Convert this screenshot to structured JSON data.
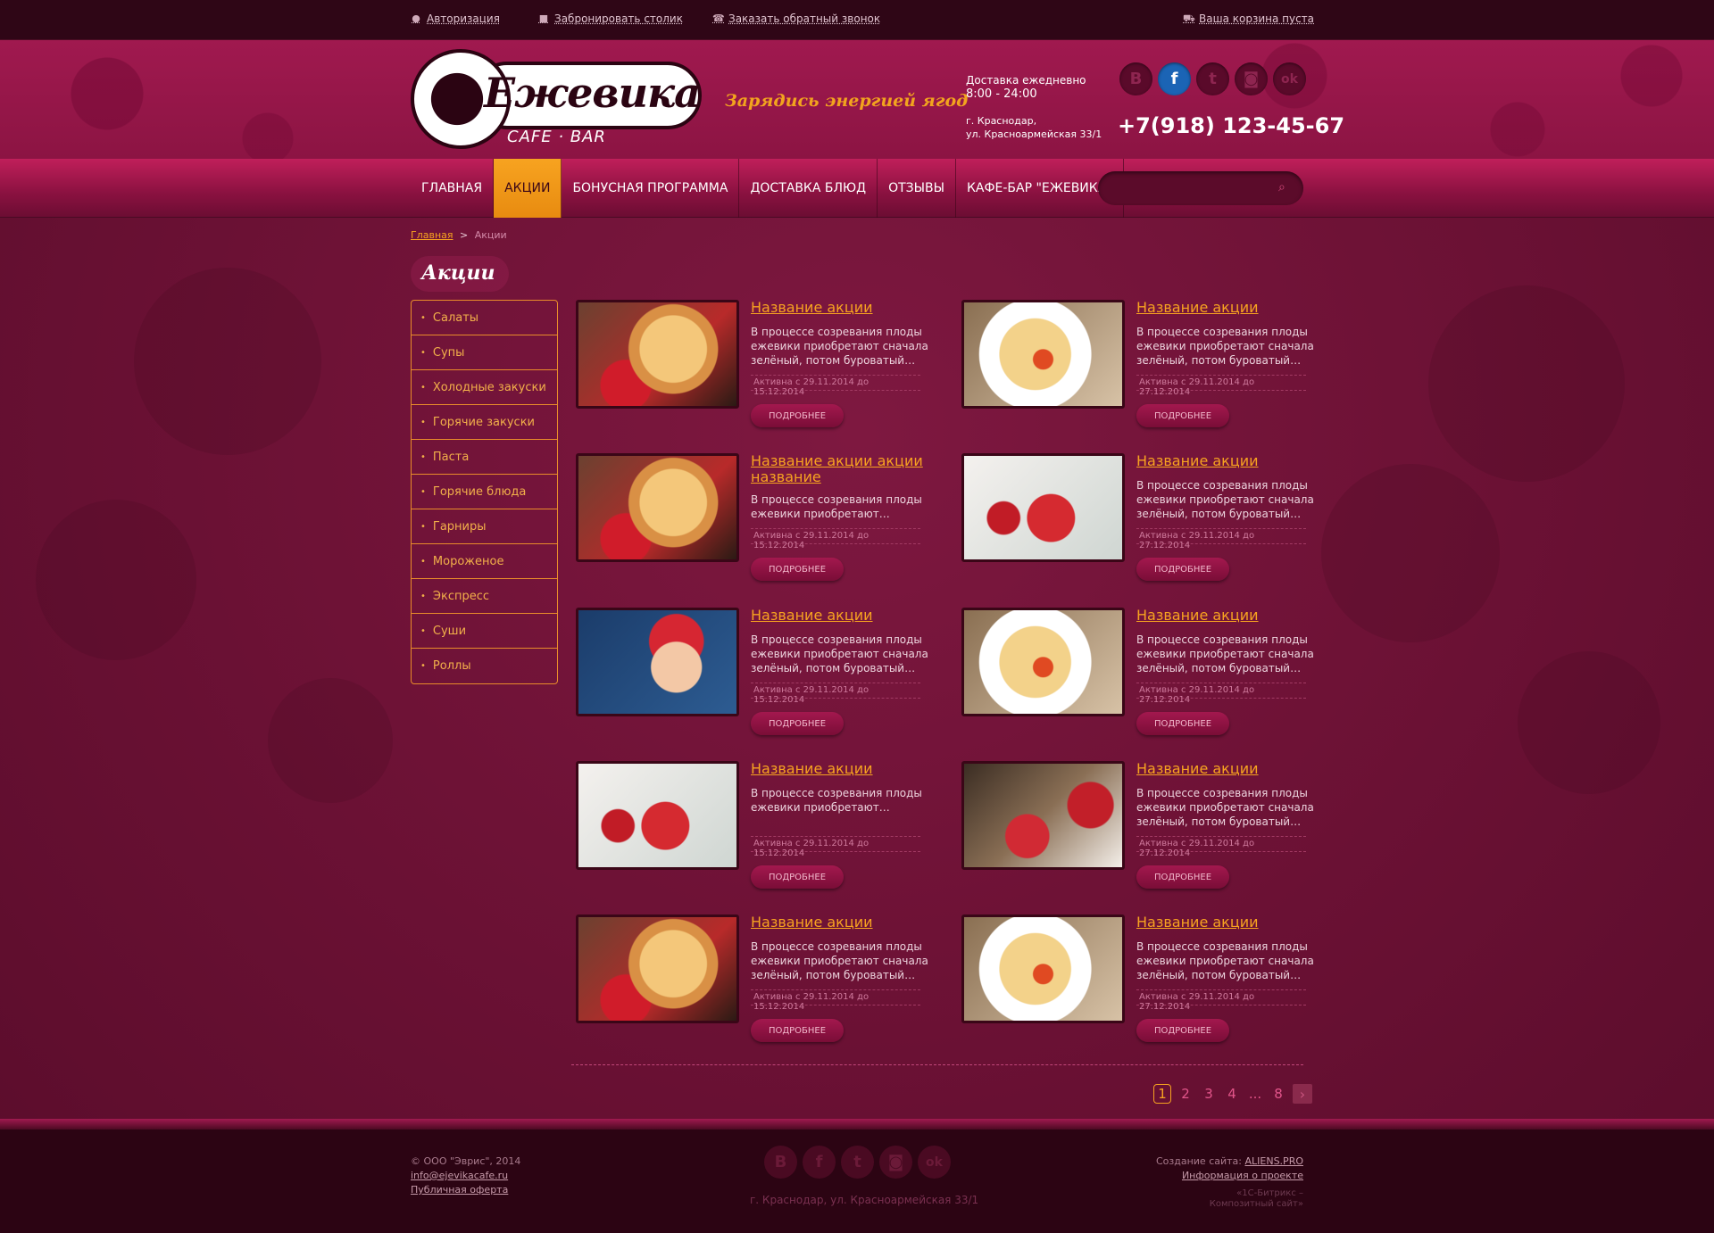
{
  "topbar": {
    "login_label": "Авторизация",
    "reserve_label": "Забронировать столик",
    "callback_label": "Заказать обратный звонок",
    "cart_label": "Ваша корзина пуста"
  },
  "header": {
    "logo_name": "Ежевика",
    "logo_sub": "CAFE · BAR",
    "slogan": "Зарядись энергией ягод",
    "delivery_line1": "Доставка ежедневно",
    "delivery_line2": "8:00 - 24:00",
    "address_line1": "г. Краснодар,",
    "address_line2": "ул. Красноармейская 33/1",
    "phone": "+7(918) 123-45-67",
    "social": [
      {
        "name": "vk-icon",
        "glyph": "B"
      },
      {
        "name": "facebook-icon",
        "glyph": "f"
      },
      {
        "name": "twitter-icon",
        "glyph": "t"
      },
      {
        "name": "instagram-icon",
        "glyph": "◙"
      },
      {
        "name": "odnoklassniki-icon",
        "glyph": "ok"
      }
    ]
  },
  "nav": {
    "items": [
      "ГЛАВНАЯ",
      "АКЦИИ",
      "БОНУСНАЯ ПРОГРАММА",
      "ДОСТАВКА БЛЮД",
      "ОТЗЫВЫ",
      "КАФЕ-БАР \"ЕЖЕВИКА\""
    ],
    "active_index": 1,
    "search_placeholder": ""
  },
  "breadcrumb": {
    "home": "Главная",
    "separator": ">",
    "current": "Акции"
  },
  "page_title": "Акции",
  "sidebar": {
    "items": [
      "Салаты",
      "Супы",
      "Холодные закуски",
      "Горячие закуски",
      "Паста",
      "Горячие блюда",
      "Гарниры",
      "Мороженое",
      "Экспресс",
      "Суши",
      "Роллы"
    ]
  },
  "cards": [
    {
      "title": "Название акции",
      "text": "В процессе созревания плоды ежевики приобретают сначала зелёный, потом буроватый…",
      "date": "Активна с 29.11.2014 до 15.12.2014",
      "button": "Подробнее",
      "image": "pancake"
    },
    {
      "title": "Название акции",
      "text": "В процессе созревания плоды ежевики приобретают сначала зелёный, потом буроватый…",
      "date": "Активна с 29.11.2014 до 27.12.2014",
      "button": "Подробнее",
      "image": "pasta"
    },
    {
      "title": "Название акции акции название",
      "text": "В процессе созревания плоды ежевики приобретают…",
      "date": "Активна с 29.11.2014 до 15.12.2014",
      "button": "Подробнее",
      "image": "pancake"
    },
    {
      "title": "Название акции",
      "text": "В процессе созревания плоды ежевики приобретают сначала зелёный, потом буроватый…",
      "date": "Активна с 29.11.2014 до 27.12.2014",
      "button": "Подробнее",
      "image": "gifts"
    },
    {
      "title": "Название акции",
      "text": "В процессе созревания плоды ежевики приобретают сначала зелёный, потом буроватый…",
      "date": "Активна с 29.11.2014 до 15.12.2014",
      "button": "Подробнее",
      "image": "santa"
    },
    {
      "title": "Название акции",
      "text": "В процессе созревания плоды ежевики приобретают сначала зелёный, потом буроватый…",
      "date": "Активна с 29.11.2014 до 27.12.2014",
      "button": "Подробнее",
      "image": "pasta"
    },
    {
      "title": "Название акции",
      "text": "В процессе созревания плоды ежевики приобретают…",
      "date": "Активна с 29.11.2014 до 15.12.2014",
      "button": "Подробнее",
      "image": "gifts"
    },
    {
      "title": "Название акции",
      "text": "В процессе созревания плоды ежевики приобретают сначала зелёный, потом буроватый…",
      "date": "Активна с 29.11.2014 до 27.12.2014",
      "button": "Подробнее",
      "image": "xmas2"
    },
    {
      "title": "Название акции",
      "text": "В процессе созревания плоды ежевики приобретают сначала зелёный, потом буроватый…",
      "date": "Активна с 29.11.2014 до 15.12.2014",
      "button": "Подробнее",
      "image": "pancake"
    },
    {
      "title": "Название акции",
      "text": "В процессе созревания плоды ежевики приобретают сначала зелёный, потом буроватый…",
      "date": "Активна с 29.11.2014 до 27.12.2014",
      "button": "Подробнее",
      "image": "pasta"
    }
  ],
  "pagination": {
    "pages": [
      "1",
      "2",
      "3",
      "4",
      "...",
      "8"
    ],
    "active": "1",
    "next": "›"
  },
  "footer": {
    "copyright": "© ООО \"Эврис\", 2014",
    "email": "info@ejevikacafe.ru",
    "offer": "Публичная оферта",
    "address": "г. Краснодар, ул. Красноармейская 33/1",
    "created_label": "Создание сайта:",
    "created_link": "ALIENS.PRO",
    "project_info": "Информация о проекте",
    "bitrix_line1": "«1С-Битрикс –",
    "bitrix_line2": "Композитный сайт»"
  },
  "colors": {
    "accent": "#f7a320",
    "bg": "#6a0f32",
    "nav_active": "#f7a320"
  }
}
